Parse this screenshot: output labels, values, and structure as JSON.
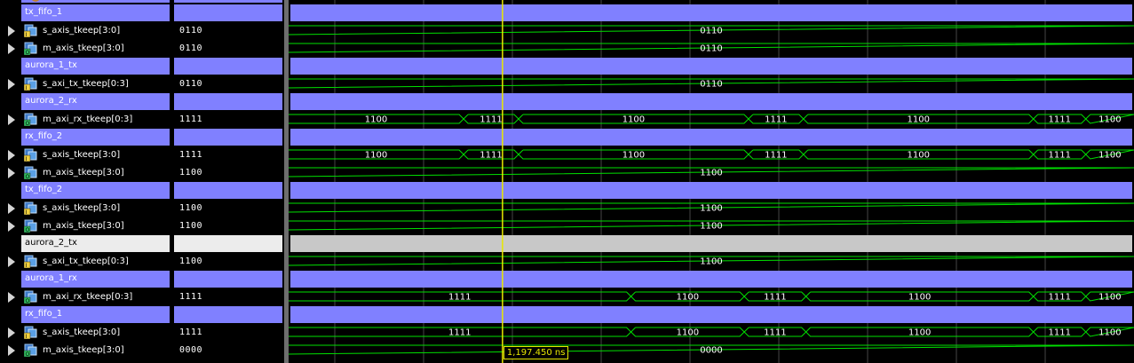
{
  "top_partial_group": "",
  "rows": [
    {
      "kind": "group",
      "name": "tx_fifo_1"
    },
    {
      "kind": "sig",
      "dir": "in",
      "name": "s_axis_tkeep[3:0]",
      "value": "0110",
      "wave": [
        {
          "val": "0110",
          "from": 0,
          "to": 1
        }
      ]
    },
    {
      "kind": "sig",
      "dir": "out",
      "name": "m_axis_tkeep[3:0]",
      "value": "0110",
      "wave": [
        {
          "val": "0110",
          "from": 0,
          "to": 1
        }
      ]
    },
    {
      "kind": "group",
      "name": "aurora_1_tx"
    },
    {
      "kind": "sig",
      "dir": "in",
      "name": "s_axi_tx_tkeep[0:3]",
      "value": "0110",
      "wave": [
        {
          "val": "0110",
          "from": 0,
          "to": 1
        }
      ]
    },
    {
      "kind": "group",
      "name": "aurora_2_rx"
    },
    {
      "kind": "sig",
      "dir": "out",
      "name": "m_axi_rx_tkeep[0:3]",
      "value": "1111",
      "wave": [
        {
          "val": "1100",
          "from": 0,
          "to": 0.207
        },
        {
          "val": "1111",
          "from": 0.207,
          "to": 0.272
        },
        {
          "val": "1100",
          "from": 0.272,
          "to": 0.544
        },
        {
          "val": "1111",
          "from": 0.544,
          "to": 0.609
        },
        {
          "val": "1100",
          "from": 0.609,
          "to": 0.881
        },
        {
          "val": "1111",
          "from": 0.881,
          "to": 0.943
        },
        {
          "val": "1100",
          "from": 0.943,
          "to": 1
        }
      ]
    },
    {
      "kind": "group",
      "name": "rx_fifo_2"
    },
    {
      "kind": "sig",
      "dir": "in",
      "name": "s_axis_tkeep[3:0]",
      "value": "1111",
      "wave": [
        {
          "val": "1100",
          "from": 0,
          "to": 0.207
        },
        {
          "val": "1111",
          "from": 0.207,
          "to": 0.272
        },
        {
          "val": "1100",
          "from": 0.272,
          "to": 0.544
        },
        {
          "val": "1111",
          "from": 0.544,
          "to": 0.609
        },
        {
          "val": "1100",
          "from": 0.609,
          "to": 0.881
        },
        {
          "val": "1111",
          "from": 0.881,
          "to": 0.943
        },
        {
          "val": "1100",
          "from": 0.943,
          "to": 1
        }
      ]
    },
    {
      "kind": "sig",
      "dir": "out",
      "name": "m_axis_tkeep[3:0]",
      "value": "1100",
      "wave": [
        {
          "val": "1100",
          "from": 0,
          "to": 1
        }
      ]
    },
    {
      "kind": "group",
      "name": "tx_fifo_2"
    },
    {
      "kind": "sig",
      "dir": "in",
      "name": "s_axis_tkeep[3:0]",
      "value": "1100",
      "wave": [
        {
          "val": "1100",
          "from": 0,
          "to": 1
        }
      ]
    },
    {
      "kind": "sig",
      "dir": "out",
      "name": "m_axis_tkeep[3:0]",
      "value": "1100",
      "wave": [
        {
          "val": "1100",
          "from": 0,
          "to": 1
        }
      ]
    },
    {
      "kind": "group",
      "name": "aurora_2_tx",
      "selected": true
    },
    {
      "kind": "sig",
      "dir": "in",
      "name": "s_axi_tx_tkeep[0:3]",
      "value": "1100",
      "wave": [
        {
          "val": "1100",
          "from": 0,
          "to": 1
        }
      ]
    },
    {
      "kind": "group",
      "name": "aurora_1_rx"
    },
    {
      "kind": "sig",
      "dir": "out",
      "name": "m_axi_rx_tkeep[0:3]",
      "value": "1111",
      "wave": [
        {
          "val": "1111",
          "from": 0,
          "to": 0.405
        },
        {
          "val": "1100",
          "from": 0.405,
          "to": 0.539
        },
        {
          "val": "1111",
          "from": 0.539,
          "to": 0.612
        },
        {
          "val": "1100",
          "from": 0.612,
          "to": 0.881
        },
        {
          "val": "1111",
          "from": 0.881,
          "to": 0.943
        },
        {
          "val": "1100",
          "from": 0.943,
          "to": 1
        }
      ]
    },
    {
      "kind": "group",
      "name": "rx_fifo_1"
    },
    {
      "kind": "sig",
      "dir": "in",
      "name": "s_axis_tkeep[3:0]",
      "value": "1111",
      "wave": [
        {
          "val": "1111",
          "from": 0,
          "to": 0.405
        },
        {
          "val": "1100",
          "from": 0.405,
          "to": 0.539
        },
        {
          "val": "1111",
          "from": 0.539,
          "to": 0.612
        },
        {
          "val": "1100",
          "from": 0.612,
          "to": 0.881
        },
        {
          "val": "1111",
          "from": 0.881,
          "to": 0.943
        },
        {
          "val": "1100",
          "from": 0.943,
          "to": 1
        }
      ]
    },
    {
      "kind": "sig",
      "dir": "out",
      "name": "m_axis_tkeep[3:0]",
      "value": "0000",
      "wave": [
        {
          "val": "0000",
          "from": 0,
          "to": 1
        }
      ]
    }
  ],
  "cursor": {
    "label": "1,197.450 ns",
    "pos": 0.253
  },
  "colors": {
    "group_bar": "#8080ff",
    "wave": "#00e000",
    "grid": "#ffffff",
    "cursor": "#e8e800",
    "selected_group": "#c8c8c8"
  },
  "icons": {
    "in": "input-port-icon",
    "out": "output-port-icon",
    "expander": "expand-arrow-icon"
  }
}
